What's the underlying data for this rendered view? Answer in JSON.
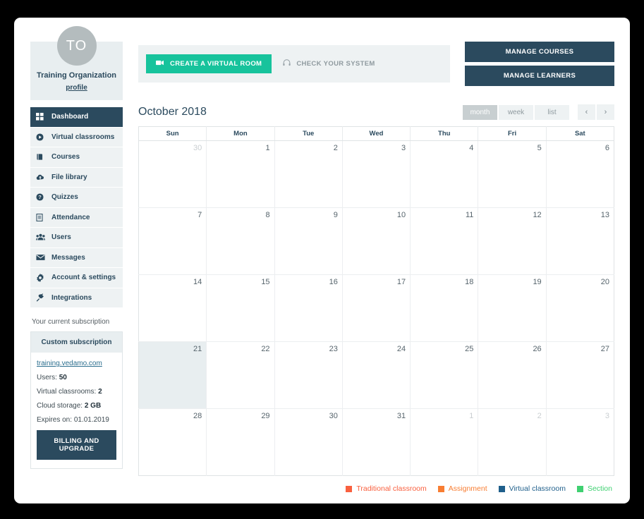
{
  "sidebar": {
    "avatar_initials": "TO",
    "org_name": "Training Organization",
    "profile_link": "profile",
    "nav": [
      {
        "label": "Dashboard",
        "icon": "dashboard-grid-icon",
        "active": true
      },
      {
        "label": "Virtual classrooms",
        "icon": "play-circle-icon",
        "active": false
      },
      {
        "label": "Courses",
        "icon": "book-icon",
        "active": false
      },
      {
        "label": "File library",
        "icon": "cloud-upload-icon",
        "active": false
      },
      {
        "label": "Quizzes",
        "icon": "question-circle-icon",
        "active": false
      },
      {
        "label": "Attendance",
        "icon": "document-icon",
        "active": false
      },
      {
        "label": "Users",
        "icon": "users-group-icon",
        "active": false
      },
      {
        "label": "Messages",
        "icon": "envelope-icon",
        "active": false
      },
      {
        "label": "Account & settings",
        "icon": "gear-icon",
        "active": false
      },
      {
        "label": "Integrations",
        "icon": "plug-icon",
        "active": false
      }
    ],
    "subscription": {
      "caption": "Your current subscription",
      "plan_title": "Custom subscription",
      "url": "training.vedamo.com",
      "rows": [
        {
          "label": "Users:",
          "value": "50"
        },
        {
          "label": "Virtual classrooms:",
          "value": "2"
        },
        {
          "label": "Cloud storage:",
          "value": "2 GB"
        },
        {
          "label": "Expires on:",
          "value": "01.01.2019"
        }
      ],
      "billing_button": "BILLING AND UPGRADE"
    }
  },
  "toolbar": {
    "create_room_label": "CREATE A VIRTUAL ROOM",
    "check_system_label": "CHECK YOUR SYSTEM",
    "manage_courses_label": "MANAGE COURSES",
    "manage_learners_label": "MANAGE LEARNERS"
  },
  "calendar": {
    "title": "October 2018",
    "views": [
      {
        "label": "month",
        "active": true
      },
      {
        "label": "week",
        "active": false
      },
      {
        "label": "list",
        "active": false
      }
    ],
    "prev_label": "‹",
    "next_label": "›",
    "weekdays": [
      "Sun",
      "Mon",
      "Tue",
      "Wed",
      "Thu",
      "Fri",
      "Sat"
    ],
    "weeks": [
      [
        {
          "day": "30",
          "other": true,
          "today": false
        },
        {
          "day": "1",
          "other": false,
          "today": false
        },
        {
          "day": "2",
          "other": false,
          "today": false
        },
        {
          "day": "3",
          "other": false,
          "today": false
        },
        {
          "day": "4",
          "other": false,
          "today": false
        },
        {
          "day": "5",
          "other": false,
          "today": false
        },
        {
          "day": "6",
          "other": false,
          "today": false
        }
      ],
      [
        {
          "day": "7",
          "other": false,
          "today": false
        },
        {
          "day": "8",
          "other": false,
          "today": false
        },
        {
          "day": "9",
          "other": false,
          "today": false
        },
        {
          "day": "10",
          "other": false,
          "today": false
        },
        {
          "day": "11",
          "other": false,
          "today": false
        },
        {
          "day": "12",
          "other": false,
          "today": false
        },
        {
          "day": "13",
          "other": false,
          "today": false
        }
      ],
      [
        {
          "day": "14",
          "other": false,
          "today": false
        },
        {
          "day": "15",
          "other": false,
          "today": false
        },
        {
          "day": "16",
          "other": false,
          "today": false
        },
        {
          "day": "17",
          "other": false,
          "today": false
        },
        {
          "day": "18",
          "other": false,
          "today": false
        },
        {
          "day": "19",
          "other": false,
          "today": false
        },
        {
          "day": "20",
          "other": false,
          "today": false
        }
      ],
      [
        {
          "day": "21",
          "other": false,
          "today": true
        },
        {
          "day": "22",
          "other": false,
          "today": false
        },
        {
          "day": "23",
          "other": false,
          "today": false
        },
        {
          "day": "24",
          "other": false,
          "today": false
        },
        {
          "day": "25",
          "other": false,
          "today": false
        },
        {
          "day": "26",
          "other": false,
          "today": false
        },
        {
          "day": "27",
          "other": false,
          "today": false
        }
      ],
      [
        {
          "day": "28",
          "other": false,
          "today": false
        },
        {
          "day": "29",
          "other": false,
          "today": false
        },
        {
          "day": "30",
          "other": false,
          "today": false
        },
        {
          "day": "31",
          "other": false,
          "today": false
        },
        {
          "day": "1",
          "other": true,
          "today": false
        },
        {
          "day": "2",
          "other": true,
          "today": false
        },
        {
          "day": "3",
          "other": true,
          "today": false
        }
      ]
    ],
    "legend": [
      {
        "label": "Traditional classroom",
        "color": "#f9603f"
      },
      {
        "label": "Assignment",
        "color": "#f87d32"
      },
      {
        "label": "Virtual classroom",
        "color": "#1f5f8b"
      },
      {
        "label": "Section",
        "color": "#3fd071"
      }
    ]
  },
  "colors": {
    "brand_navy": "#2b4a5e",
    "brand_teal": "#17c39c",
    "panel_bg": "#eef2f3",
    "today_bg": "#e8eef0"
  }
}
